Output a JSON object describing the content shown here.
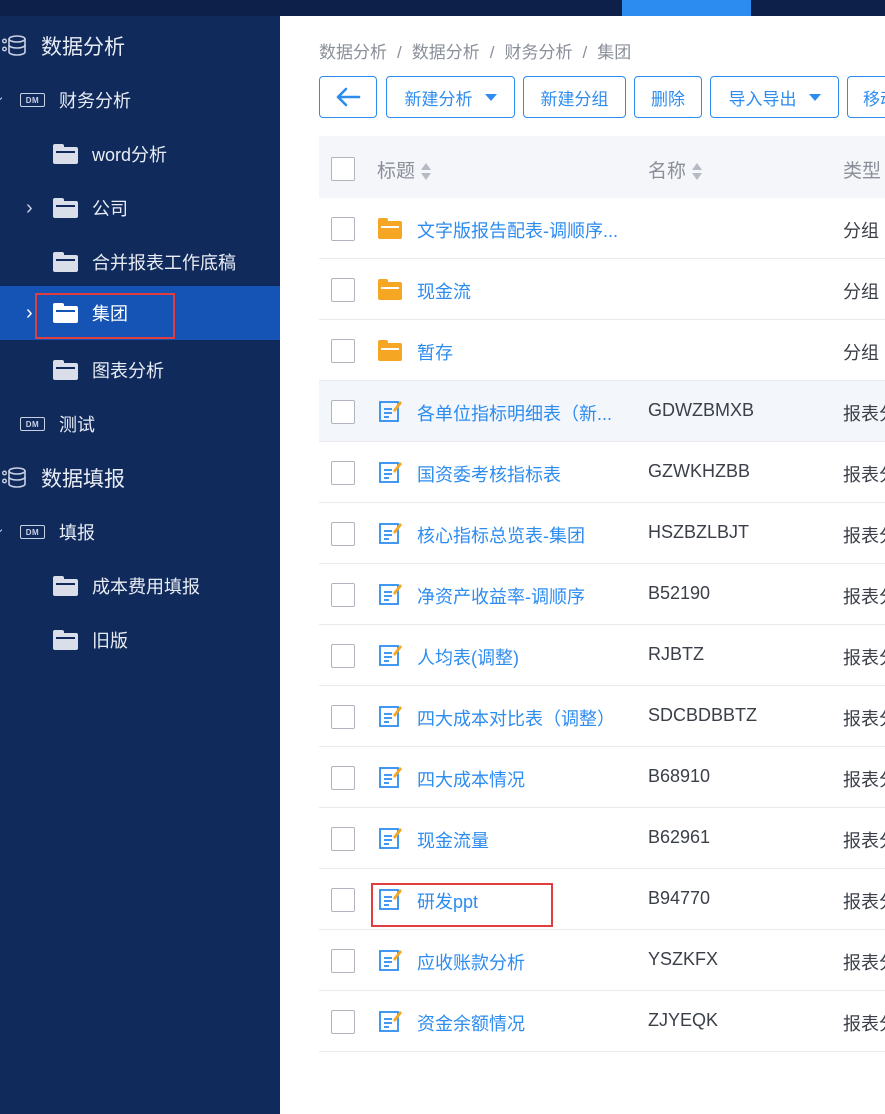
{
  "colors": {
    "sidebar": "#102a5c",
    "active": "#1554b5",
    "accent": "#2d8cf0",
    "folder": "#f5a623",
    "highlight": "#e03e3e"
  },
  "sidebar": {
    "items": [
      {
        "label": "数据分析",
        "icon": "database-icon"
      },
      {
        "label": "财务分析",
        "icon": "dm-icon"
      },
      {
        "label": "word分析",
        "icon": "folder-icon"
      },
      {
        "label": "公司",
        "icon": "folder-icon"
      },
      {
        "label": "合并报表工作底稿",
        "icon": "folder-icon"
      },
      {
        "label": "集团",
        "icon": "folder-icon"
      },
      {
        "label": "图表分析",
        "icon": "folder-icon"
      },
      {
        "label": "测试",
        "icon": "dm-icon"
      },
      {
        "label": "数据填报",
        "icon": "database-icon"
      },
      {
        "label": "填报",
        "icon": "dm-icon"
      },
      {
        "label": "成本费用填报",
        "icon": "folder-icon"
      },
      {
        "label": "旧版",
        "icon": "folder-icon"
      }
    ],
    "dm_badge": "DM"
  },
  "breadcrumb": [
    "数据分析",
    "数据分析",
    "财务分析",
    "集团"
  ],
  "breadcrumb_sep": "/",
  "toolbar": {
    "back_icon": "arrow-left-icon",
    "new_analysis": "新建分析",
    "new_group": "新建分组",
    "delete": "删除",
    "import_export": "导入导出",
    "move": "移动"
  },
  "table": {
    "headers": {
      "title": "标题",
      "name": "名称",
      "type": "类型"
    },
    "rows": [
      {
        "title": "文字版报告配表-调顺序...",
        "code": "",
        "type": "分组"
      },
      {
        "title": "现金流",
        "code": "",
        "type": "分组"
      },
      {
        "title": "暂存",
        "code": "",
        "type": "分组"
      },
      {
        "title": "各单位指标明细表（新...",
        "code": "GDWZBMXB",
        "type": "报表分"
      },
      {
        "title": "国资委考核指标表",
        "code": "GZWKHZBB",
        "type": "报表分"
      },
      {
        "title": "核心指标总览表-集团",
        "code": "HSZBZLBJT",
        "type": "报表分"
      },
      {
        "title": "净资产收益率-调顺序",
        "code": "B52190",
        "type": "报表分"
      },
      {
        "title": "人均表(调整)",
        "code": "RJBTZ",
        "type": "报表分"
      },
      {
        "title": "四大成本对比表（调整）",
        "code": "SDCBDBBTZ",
        "type": "报表分"
      },
      {
        "title": "四大成本情况",
        "code": "B68910",
        "type": "报表分"
      },
      {
        "title": "现金流量",
        "code": "B62961",
        "type": "报表分"
      },
      {
        "title": "研发ppt",
        "code": "B94770",
        "type": "报表分"
      },
      {
        "title": "应收账款分析",
        "code": "YSZKFX",
        "type": "报表分"
      },
      {
        "title": "资金余额情况",
        "code": "ZJYEQK",
        "type": "报表分"
      }
    ]
  }
}
